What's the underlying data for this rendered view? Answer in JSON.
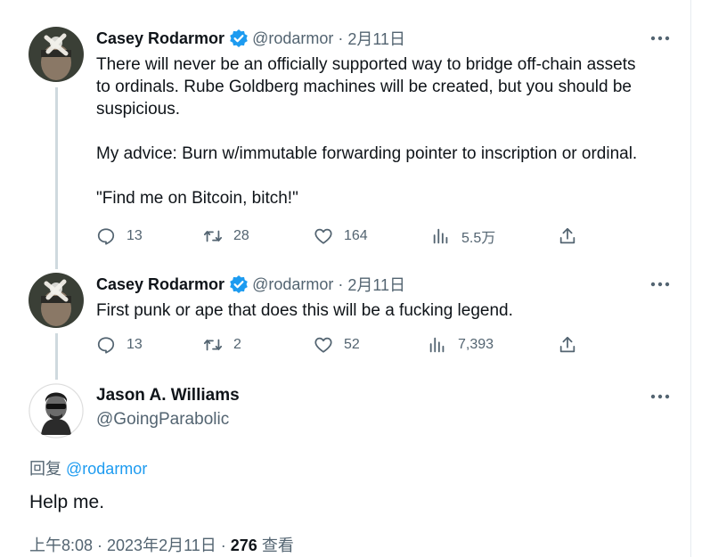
{
  "tweets": [
    {
      "author_name": "Casey Rodarmor",
      "handle": "@rodarmor",
      "separator": " · ",
      "date": "2月11日",
      "text": "There will never be an officially supported way to bridge off-chain assets\nto ordinals. Rube Goldberg machines will be created, but you should be\nsuspicious.\n\nMy advice: Burn w/immutable forwarding pointer to inscription or ordinal.\n\n\"Find me on Bitcoin, bitch!\"",
      "replies": "13",
      "retweets": "28",
      "likes": "164",
      "views": "5.5万"
    },
    {
      "author_name": "Casey Rodarmor",
      "handle": "@rodarmor",
      "separator": " · ",
      "date": "2月11日",
      "text": "First punk or ape that does this will be a fucking legend.",
      "replies": "13",
      "retweets": "2",
      "likes": "52",
      "views": "7,393"
    }
  ],
  "main_tweet": {
    "author_name": "Jason A. Williams",
    "handle": "@GoingParabolic",
    "reply_prefix": "回复 ",
    "reply_mention": "@rodarmor",
    "text": "Help me.",
    "timestamp": "上午8:08 · 2023年2月11日 · ",
    "views_count": "276",
    "views_label": " 查看"
  },
  "colors": {
    "verified": "#1d9bf0",
    "muted": "#536471",
    "text": "#0f1419",
    "link": "#1d9bf0"
  },
  "icons": [
    "verified-icon",
    "more-icon",
    "reply-icon",
    "retweet-icon",
    "like-icon",
    "views-icon",
    "share-icon"
  ]
}
